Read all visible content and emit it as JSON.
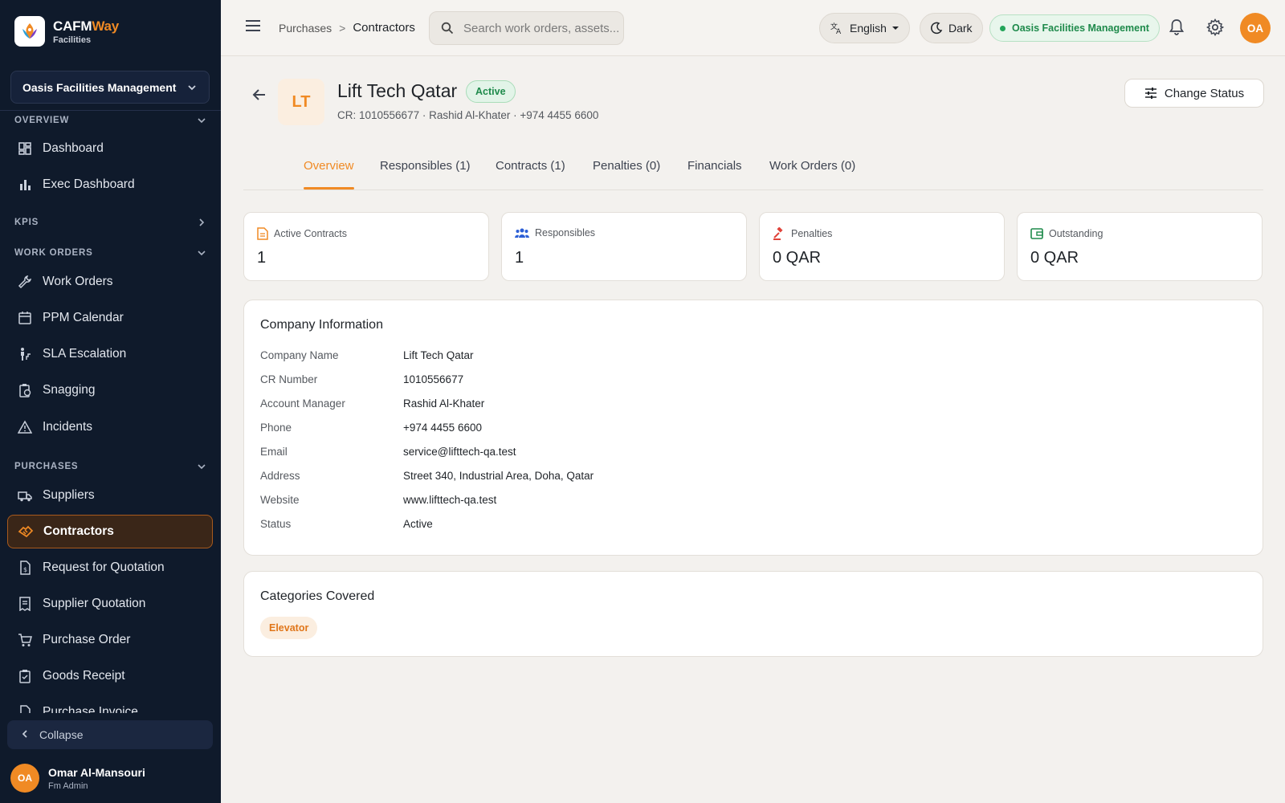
{
  "brand": {
    "name_main": "CAFM",
    "name_accent": "Way",
    "subtitle": "Facilities"
  },
  "org_selector": {
    "label": "Oasis Facilities Management"
  },
  "sidebar": {
    "sections": {
      "overview": "OVERVIEW",
      "kpis": "KPIS",
      "work_orders": "WORK ORDERS",
      "purchases": "PURCHASES"
    },
    "items": {
      "dashboard": "Dashboard",
      "exec_dashboard": "Exec Dashboard",
      "work_orders": "Work Orders",
      "ppm_calendar": "PPM Calendar",
      "sla_escalation": "SLA Escalation",
      "snagging": "Snagging",
      "incidents": "Incidents",
      "suppliers": "Suppliers",
      "contractors": "Contractors",
      "rfq": "Request for Quotation",
      "supplier_quotation": "Supplier Quotation",
      "purchase_order": "Purchase Order",
      "goods_receipt": "Goods Receipt",
      "purchase_invoice": "Purchase Invoice"
    },
    "collapse_label": "Collapse",
    "user": {
      "initials": "OA",
      "name": "Omar Al-Mansouri",
      "role": "Fm Admin"
    }
  },
  "topbar": {
    "breadcrumb": {
      "parent": "Purchases",
      "separator": ">",
      "current": "Contractors"
    },
    "search_placeholder": "Search work orders, assets...",
    "language": "English",
    "theme": "Dark",
    "org_badge": "Oasis Facilities Management",
    "avatar_initials": "OA"
  },
  "header": {
    "logo_initials": "LT",
    "title": "Lift Tech Qatar",
    "status_badge": "Active",
    "subline": "CR: 1010556677 · Rashid Al-Khater · +974 4455 6600",
    "change_status_label": "Change Status"
  },
  "tabs": [
    "Overview",
    "Responsibles (1)",
    "Contracts (1)",
    "Penalties (0)",
    "Financials",
    "Work Orders (0)"
  ],
  "stats": [
    {
      "label": "Active Contracts",
      "value": "1",
      "icon": "document-icon",
      "color": "#f08a24"
    },
    {
      "label": "Responsibles",
      "value": "1",
      "icon": "people-icon",
      "color": "#2c5fd6"
    },
    {
      "label": "Penalties",
      "value": "0 QAR",
      "icon": "gavel-icon",
      "color": "#e0433a"
    },
    {
      "label": "Outstanding",
      "value": "0 QAR",
      "icon": "wallet-icon",
      "color": "#1e8a4b"
    }
  ],
  "company_info": {
    "title": "Company Information",
    "rows": [
      {
        "key": "Company Name",
        "value": "Lift Tech Qatar"
      },
      {
        "key": "CR Number",
        "value": "1010556677"
      },
      {
        "key": "Account Manager",
        "value": "Rashid Al-Khater"
      },
      {
        "key": "Phone",
        "value": "+974 4455 6600"
      },
      {
        "key": "Email",
        "value": "service@lifttech-qa.test"
      },
      {
        "key": "Address",
        "value": "Street 340, Industrial Area, Doha, Qatar"
      },
      {
        "key": "Website",
        "value": "www.lifttech-qa.test"
      },
      {
        "key": "Status",
        "value": "Active"
      }
    ]
  },
  "categories": {
    "title": "Categories Covered",
    "items": [
      "Elevator"
    ]
  },
  "colors": {
    "accent": "#f08a24",
    "sidebar_bg": "#0f1a2b",
    "success": "#1e8a4b"
  }
}
